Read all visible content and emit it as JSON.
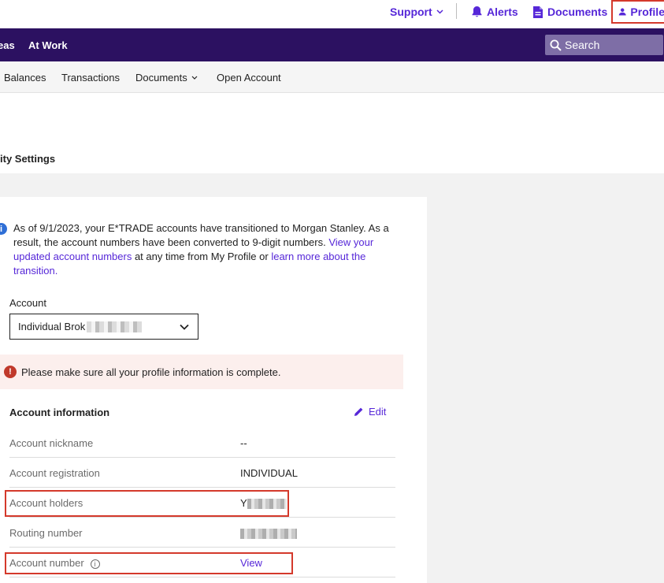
{
  "utility": {
    "support": "Support",
    "alerts": "Alerts",
    "documents": "Documents",
    "profile": "Profile"
  },
  "nav": {
    "ideas": "eas",
    "at_work": "At Work",
    "search_placeholder": "Search"
  },
  "subnav": {
    "balances": "Balances",
    "transactions": "Transactions",
    "documents": "Documents",
    "open_account": "Open Account"
  },
  "page": {
    "heading": "ity Settings"
  },
  "notice": {
    "text_1": "As of 9/1/2023, your E*TRADE accounts have transitioned to Morgan Stanley. As a result, the account numbers have been converted to 9-digit numbers. ",
    "link_1": "View your updated account numbers",
    "text_2": " at any time from My Profile or ",
    "link_2": "learn more about the transition."
  },
  "account": {
    "label": "Account",
    "selected": "Individual Brok"
  },
  "alert": {
    "text": "Please make sure all your profile information is complete."
  },
  "account_info": {
    "title": "Account information",
    "edit": "Edit",
    "rows": [
      {
        "label": "Account nickname",
        "value": "--"
      },
      {
        "label": "Account registration",
        "value": "INDIVIDUAL"
      },
      {
        "label": "Account holders",
        "value": "Y"
      },
      {
        "label": "Routing number",
        "value": ""
      },
      {
        "label": "Account number",
        "value": "View"
      }
    ]
  },
  "colors": {
    "brand_purple": "#2c1161",
    "link_purple": "#5627d8",
    "highlight_red": "#d4392b",
    "alert_bg": "#fcefed"
  }
}
